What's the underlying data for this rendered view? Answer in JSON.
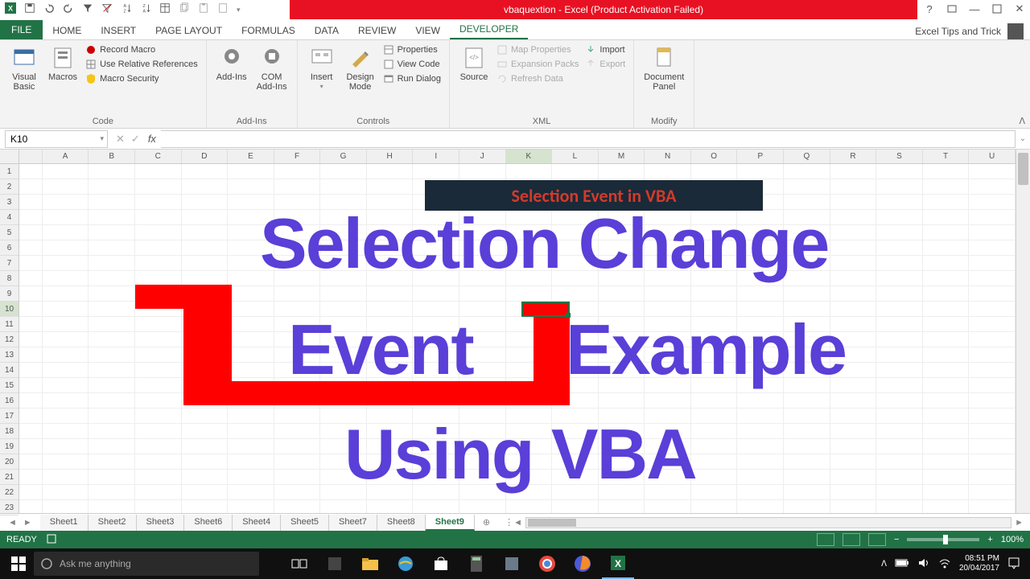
{
  "title": "vbaquextion - Excel (Product Activation Failed)",
  "qat_icons": [
    "excel",
    "save",
    "undo",
    "redo",
    "filter",
    "sort-asc",
    "sort-za",
    "sort-az",
    "table",
    "copy",
    "paste",
    "paste-special"
  ],
  "ribbon": {
    "tabs": [
      "FILE",
      "HOME",
      "INSERT",
      "PAGE LAYOUT",
      "FORMULAS",
      "DATA",
      "REVIEW",
      "VIEW",
      "DEVELOPER"
    ],
    "active": "DEVELOPER",
    "right_label": "Excel Tips and Trick"
  },
  "groups": {
    "code": {
      "visual_basic": "Visual\nBasic",
      "macros": "Macros",
      "record": "Record Macro",
      "relative": "Use Relative References",
      "security": "Macro Security",
      "label": "Code"
    },
    "addins": {
      "addins": "Add-Ins",
      "com": "COM\nAdd-Ins",
      "label": "Add-Ins"
    },
    "controls": {
      "insert": "Insert",
      "design": "Design\nMode",
      "properties": "Properties",
      "view_code": "View Code",
      "run_dialog": "Run Dialog",
      "label": "Controls"
    },
    "xml": {
      "source": "Source",
      "map_prop": "Map Properties",
      "expansion": "Expansion Packs",
      "refresh": "Refresh Data",
      "import": "Import",
      "export": "Export",
      "label": "XML"
    },
    "modify": {
      "doc_panel": "Document\nPanel",
      "label": "Modify"
    }
  },
  "name_box": "K10",
  "columns": [
    "A",
    "B",
    "C",
    "D",
    "E",
    "F",
    "G",
    "H",
    "I",
    "J",
    "K",
    "L",
    "M",
    "N",
    "O",
    "P",
    "Q",
    "R",
    "S",
    "T",
    "U"
  ],
  "active_col": "K",
  "rows": [
    "1",
    "2",
    "3",
    "4",
    "5",
    "6",
    "7",
    "8",
    "9",
    "10",
    "11",
    "12",
    "13",
    "14",
    "15",
    "16",
    "17",
    "18",
    "19",
    "20",
    "21",
    "22",
    "23"
  ],
  "active_row": "10",
  "banner": "Selection Event in VBA",
  "overlay_text": {
    "t1": "Selection Change",
    "t2": "Event",
    "t3": "Example",
    "t4": "Using VBA"
  },
  "sheets": [
    "Sheet1",
    "Sheet2",
    "Sheet3",
    "Sheet6",
    "Sheet4",
    "Sheet5",
    "Sheet7",
    "Sheet8",
    "Sheet9"
  ],
  "active_sheet": "Sheet9",
  "status": {
    "ready": "READY",
    "zoom": "100%"
  },
  "search_placeholder": "Ask me anything",
  "clock": {
    "time": "08:51 PM",
    "date": "20/04/2017"
  }
}
